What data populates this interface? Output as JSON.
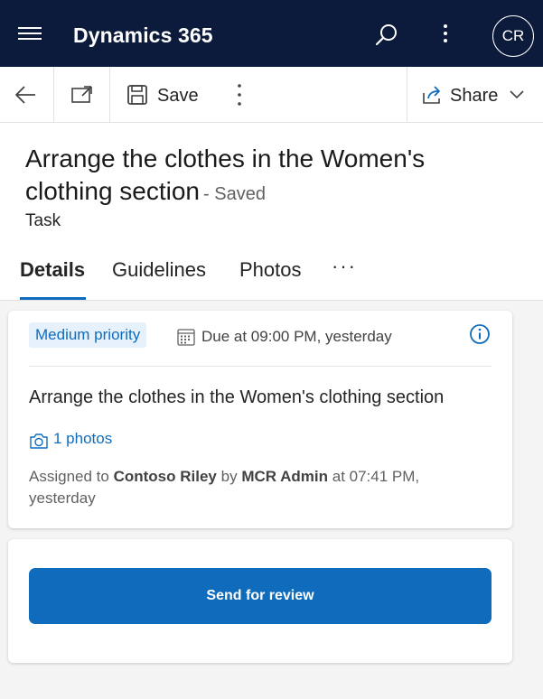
{
  "topbar": {
    "app_title": "Dynamics 365",
    "avatar_initials": "CR"
  },
  "commandbar": {
    "save_label": "Save",
    "share_label": "Share"
  },
  "record": {
    "title": "Arrange the clothes in the Women's clothing section",
    "save_status": "- Saved",
    "entity_type": "Task"
  },
  "tabs": [
    {
      "label": "Details",
      "selected": true
    },
    {
      "label": "Guidelines",
      "selected": false
    },
    {
      "label": "Photos",
      "selected": false
    }
  ],
  "tab_overflow": "···",
  "task_card": {
    "priority": "Medium priority",
    "due": "Due at 09:00 PM, yesterday",
    "description": "Arrange the clothes in the Women's clothing section",
    "photos_link": "1 photos",
    "assigned_prefix": "Assigned to",
    "assigned_to": "Contoso Riley",
    "assigned_by_prefix": "by",
    "assigned_by": "MCR Admin",
    "assigned_at": "at 07:41 PM, yesterday"
  },
  "action_card": {
    "send_for_review_label": "Send for review"
  },
  "colors": {
    "topbar_bg": "#0c1b3b",
    "accent": "#0f6cbd",
    "badge_bg": "#e6f1fb",
    "page_bg": "#f4f4f4"
  },
  "icons": [
    "hamburger-icon",
    "search-icon",
    "more-vertical-icon",
    "back-arrow-icon",
    "open-in-new-window-icon",
    "save-disk-icon",
    "share-icon",
    "chevron-down-icon",
    "calendar-icon",
    "info-icon",
    "camera-icon"
  ]
}
